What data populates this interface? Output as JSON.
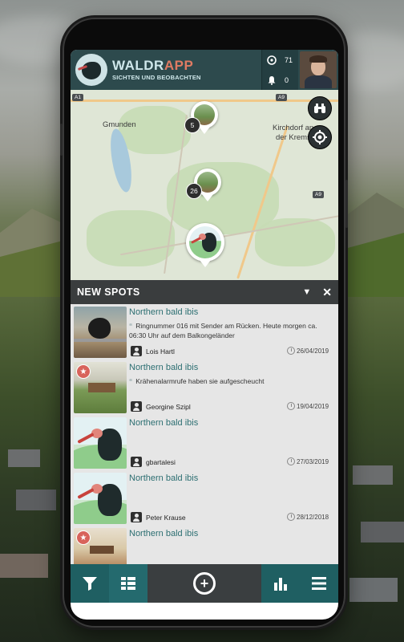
{
  "app": {
    "brand_part1": "WALDR",
    "brand_part2": "APP",
    "subtitle": "SICHTEN UND BEOBACHTEN",
    "accent": "#1f5f62",
    "brand_accent": "#e07b63"
  },
  "header": {
    "sightings_count": "71",
    "notifications_count": "0"
  },
  "map": {
    "labels": {
      "gmunden": "Gmunden",
      "kirchdorf_line1": "Kirchdorf an",
      "kirchdorf_line2": "der Krems"
    },
    "road_signs": [
      "A1",
      "A9",
      "A9"
    ],
    "clusters": [
      {
        "count": "5"
      },
      {
        "count": "26"
      }
    ]
  },
  "panel": {
    "title": "NEW SPOTS"
  },
  "spots": [
    {
      "title": "Northern bald ibis",
      "description": "Ringnummer 016 mit Sender am Rücken. Heute morgen ca. 06:30 Uhr auf dem Balkongeländer",
      "user": "Lois Hartl",
      "date": "26/04/2019",
      "starred": false
    },
    {
      "title": "Northern bald ibis",
      "description": "Krähenalarmrufe haben sie aufgescheucht",
      "user": "Georgine Szipl",
      "date": "19/04/2019",
      "starred": true
    },
    {
      "title": "Northern bald ibis",
      "description": "",
      "user": "gbartalesi",
      "date": "27/03/2019",
      "starred": false
    },
    {
      "title": "Northern bald ibis",
      "description": "",
      "user": "Peter Krause",
      "date": "28/12/2018",
      "starred": false
    },
    {
      "title": "Northern bald ibis",
      "description": "",
      "user": "",
      "date": "",
      "starred": true
    }
  ],
  "icons": {
    "filter": "filter-icon",
    "list": "list-view-icon",
    "add": "add-spot-icon",
    "stats": "statistics-icon",
    "menu": "hamburger-menu-icon",
    "binoculars": "binoculars-icon",
    "locate": "locate-icon"
  }
}
